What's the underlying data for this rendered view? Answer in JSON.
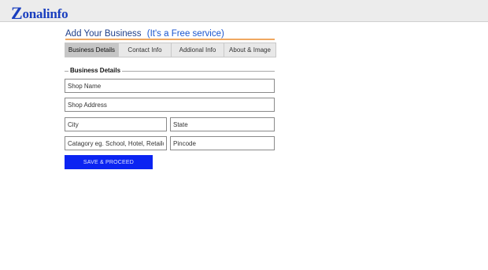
{
  "header": {
    "logo_initial": "Z",
    "logo_rest": "onalinfo"
  },
  "page": {
    "title_main": "Add Your Business",
    "title_sub": "(It's a Free service)"
  },
  "tabs": [
    {
      "label": "Business Details",
      "active": true
    },
    {
      "label": "Contact Info",
      "active": false
    },
    {
      "label": "Addional Info",
      "active": false
    },
    {
      "label": "About & Image",
      "active": false
    }
  ],
  "form": {
    "legend": "Business Details",
    "shop_name": {
      "placeholder": "Shop Name",
      "value": ""
    },
    "shop_address": {
      "placeholder": "Shop Address",
      "value": ""
    },
    "city": {
      "placeholder": "City",
      "value": ""
    },
    "state": {
      "placeholder": "State",
      "value": ""
    },
    "category": {
      "placeholder": "Catagory eg. School, Hotel, Retailor etc.",
      "value": ""
    },
    "pincode": {
      "placeholder": "Pincode",
      "value": ""
    },
    "submit_label": "SAVE & PROCEED"
  },
  "colors": {
    "brand": "#1a3fbf",
    "accent_line": "#f0a860",
    "button": "#0b24f2"
  }
}
